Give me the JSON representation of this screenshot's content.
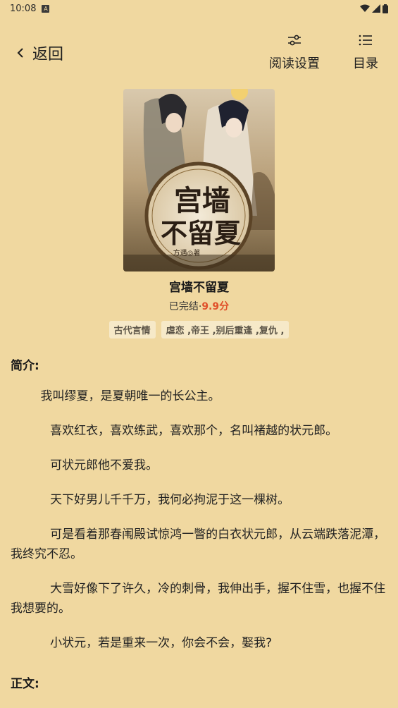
{
  "status_bar": {
    "time": "10:08",
    "notif_glyph": "A"
  },
  "header": {
    "back_label": "返回",
    "settings_label": "阅读设置",
    "toc_label": "目录"
  },
  "book": {
    "cover_title_line1": "宫墙",
    "cover_title_line2": "不留夏",
    "cover_author": "方遇◎著",
    "title": "宫墙不留夏",
    "status": "已完结·",
    "score": "9.9分",
    "tags": [
      "古代言情",
      "虐恋 ,帝王 ,别后重逢 ,复仇 ,"
    ]
  },
  "intro_heading": "简介:",
  "intro_paragraphs": [
    "我叫缪夏，是夏朝唯一的长公主。",
    "喜欢红衣，喜欢练武，喜欢那个，名叫褚越的状元郎。",
    "可状元郎他不爱我。",
    "天下好男儿千千万，我何必拘泥于这一棵树。",
    "可是看着那春闱殿试惊鸿一瞥的白衣状元郎，从云端跌落泥潭，我终究不忍。",
    "大雪好像下了许久，冷的刺骨，我伸出手，握不住雪，也握不住我想要的。",
    "小状元，若是重来一次，你会不会，娶我?"
  ],
  "body_heading": "正文:",
  "colors": {
    "background": "#f0d8a0",
    "score": "#e0502a",
    "tag_bg": "#f6e9c8"
  }
}
